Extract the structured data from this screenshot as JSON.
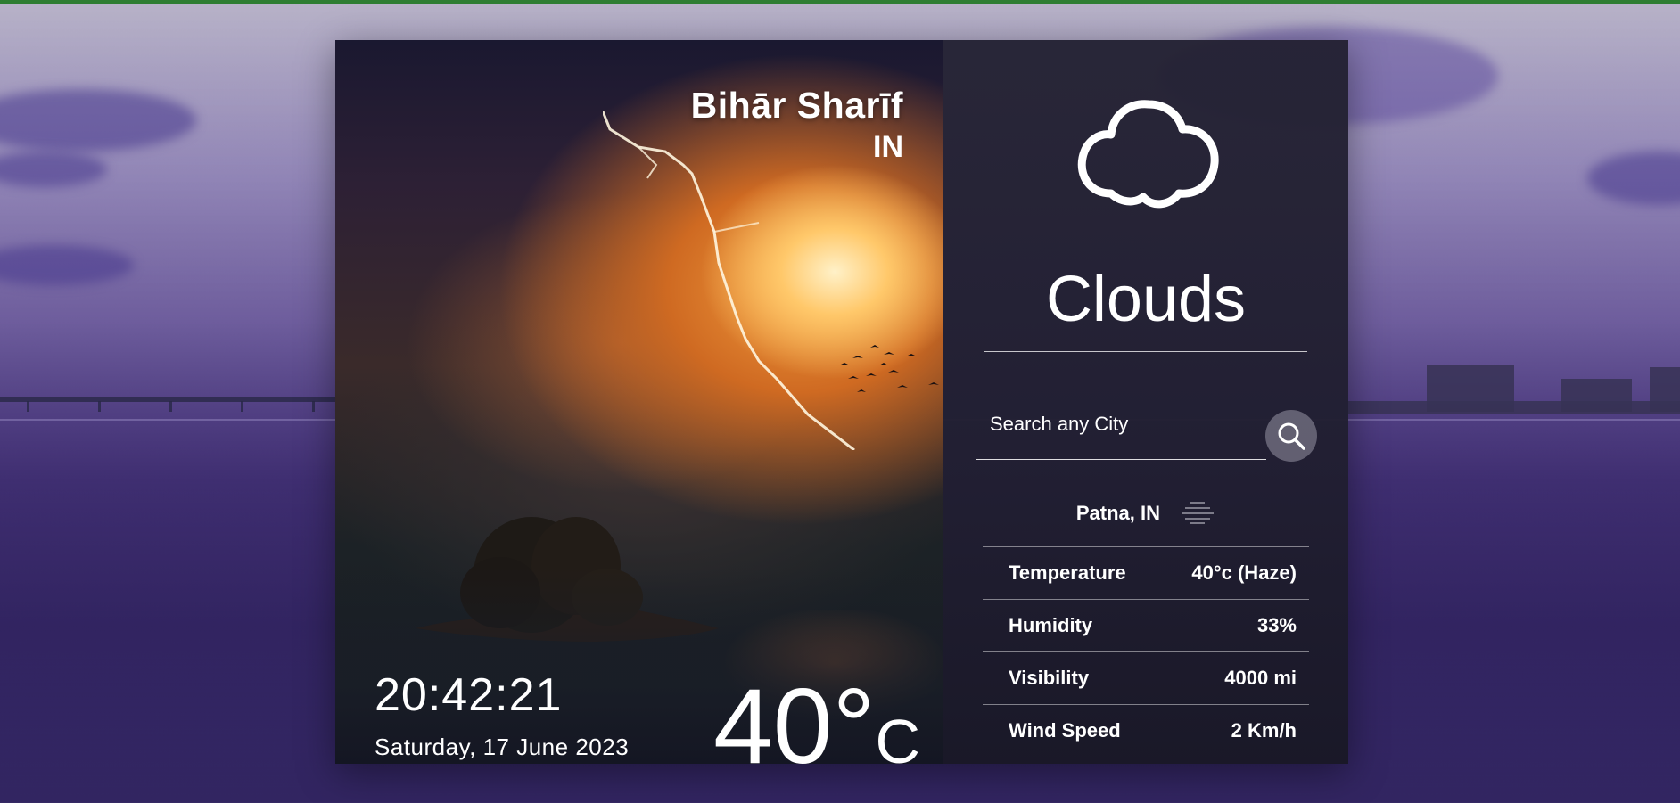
{
  "city": {
    "name": "Bihār Sharīf",
    "country": "IN"
  },
  "clock": {
    "time": "20:42:21",
    "date": "Saturday, 17 June 2023"
  },
  "current": {
    "temp_value": "40",
    "temp_degree": "°",
    "temp_unit": "C",
    "condition": "Clouds",
    "icon": "cloud-icon"
  },
  "search": {
    "placeholder": "Search any City",
    "value": "",
    "button_icon": "search-icon"
  },
  "result": {
    "location": "Patna, IN",
    "icon": "haze-icon"
  },
  "details": [
    {
      "label": "Temperature",
      "value": "40°c (Haze)"
    },
    {
      "label": "Humidity",
      "value": "33%"
    },
    {
      "label": "Visibility",
      "value": "4000 mi"
    },
    {
      "label": "Wind Speed",
      "value": "2 Km/h"
    }
  ],
  "colors": {
    "top_bar": "#2e7d32",
    "panel_dark": "#23213a",
    "text": "#ffffff"
  }
}
